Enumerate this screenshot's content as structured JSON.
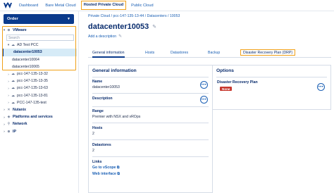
{
  "topnav": {
    "items": [
      {
        "label": "Dashboard"
      },
      {
        "label": "Bare Metal Cloud"
      },
      {
        "label": "Hosted Private Cloud"
      },
      {
        "label": "Public Cloud"
      }
    ]
  },
  "sidebar": {
    "order_label": "Order",
    "tree": {
      "vmware": "VMware",
      "search_placeholder": "Search",
      "ad_test": "AD Test PCC",
      "dc_selected": "datacenter10053",
      "dc_2": "datacenter10064",
      "dc_3": "datacenter10065",
      "pcc_1": "pcc-147-135-13-32",
      "pcc_2": "pcc-147-135-13-35",
      "pcc_3": "pcc-147-135-13-63",
      "pcc_4": "pcc-147-135-13-81",
      "pcc_5": "PCC-147-135-test",
      "nutanix": "Nutanix",
      "platforms": "Platforms and services",
      "network": "Network",
      "ip": "IP"
    }
  },
  "main": {
    "breadcrumb": "Private Cloud / pcc-147-135-13-44 / Datacenters / 10053",
    "title": "datacenter10053",
    "add_description": "Add a description",
    "tabs": {
      "general": "General information",
      "hosts": "Hosts",
      "datastores": "Datastores",
      "backup": "Backup",
      "drp": "Disaster Recovery Plan (DRP)"
    },
    "general": {
      "heading": "General information",
      "name_label": "Name",
      "name_value": "datacenter10053",
      "description_label": "Description",
      "range_label": "Range",
      "range_value": "Premier with NSX and vROps",
      "hosts_label": "Hosts",
      "hosts_value": "2",
      "datastores_label": "Datastores",
      "datastores_value": "2",
      "links_label": "Links",
      "link_vscope": "Go to vScope",
      "link_webinterface": "Web interface"
    },
    "options": {
      "heading": "Options",
      "drp_label": "Disaster Recovery Plan",
      "drp_status": "None"
    }
  },
  "colors": {
    "accent": "#0a3a8c",
    "highlight": "#f0a018",
    "link": "#1a5fb4",
    "badge": "#c7382e"
  }
}
